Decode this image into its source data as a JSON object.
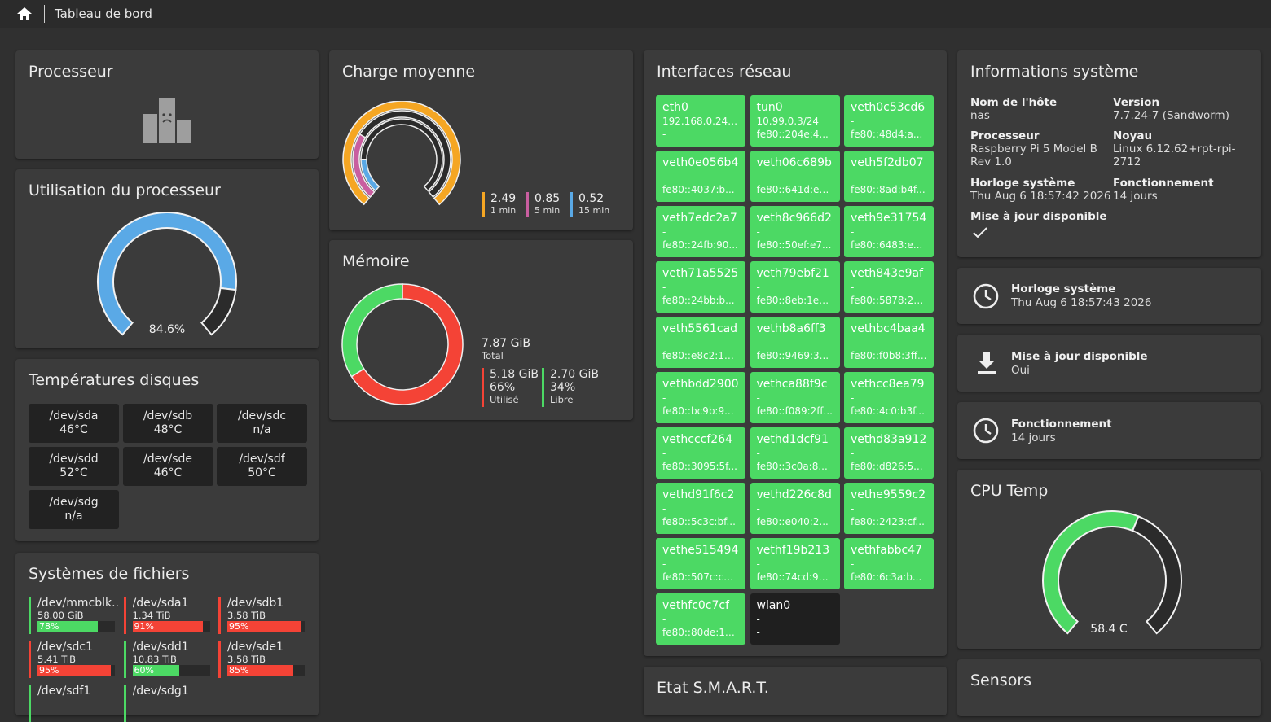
{
  "breadcrumb": {
    "title": "Tableau de bord"
  },
  "colors": {
    "green": "#4cd964",
    "red": "#f44336",
    "blue": "#5aa9e6",
    "orange": "#f5a623",
    "pink": "#c95ea0",
    "lightblue": "#5aa9e6"
  },
  "processor": {
    "title": "Processeur",
    "icon": "sad-building-icon"
  },
  "cpu_usage": {
    "title": "Utilisation du processeur",
    "value_label": "84.6%",
    "value": 84.6
  },
  "load": {
    "title": "Charge moyenne",
    "items": [
      {
        "value": "2.49",
        "label": "1 min"
      },
      {
        "value": "0.85",
        "label": "5 min"
      },
      {
        "value": "0.52",
        "label": "15 min"
      }
    ]
  },
  "memory": {
    "title": "Mémoire",
    "total_value": "7.87 GiB",
    "total_label": "Total",
    "used_value": "5.18 GiB",
    "used_pct": "66%",
    "used_label": "Utilisé",
    "free_value": "2.70 GiB",
    "free_pct": "34%",
    "free_label": "Libre",
    "used_fraction": 0.66
  },
  "disk_temps": {
    "title": "Températures disques",
    "items": [
      {
        "dev": "/dev/sda",
        "temp": "46°C"
      },
      {
        "dev": "/dev/sdb",
        "temp": "48°C"
      },
      {
        "dev": "/dev/sdc",
        "temp": "n/a"
      },
      {
        "dev": "/dev/sdd",
        "temp": "52°C"
      },
      {
        "dev": "/dev/sde",
        "temp": "46°C"
      },
      {
        "dev": "/dev/sdf",
        "temp": "50°C"
      },
      {
        "dev": "/dev/sdg",
        "temp": "n/a"
      }
    ]
  },
  "filesystems": {
    "title": "Systèmes de fichiers",
    "items": [
      {
        "name": "/dev/mmcblk...",
        "size": "58.00 GiB",
        "pct": "78%",
        "value": 78,
        "color": "#4cd964"
      },
      {
        "name": "/dev/sda1",
        "size": "1.34 TiB",
        "pct": "91%",
        "value": 91,
        "color": "#f44336"
      },
      {
        "name": "/dev/sdb1",
        "size": "3.58 TiB",
        "pct": "95%",
        "value": 95,
        "color": "#f44336"
      },
      {
        "name": "/dev/sdc1",
        "size": "5.41 TiB",
        "pct": "95%",
        "value": 95,
        "color": "#f44336"
      },
      {
        "name": "/dev/sdd1",
        "size": "10.83 TiB",
        "pct": "60%",
        "value": 60,
        "color": "#4cd964"
      },
      {
        "name": "/dev/sde1",
        "size": "3.58 TiB",
        "pct": "85%",
        "value": 85,
        "color": "#f44336"
      },
      {
        "name": "/dev/sdf1",
        "size": "",
        "pct": "",
        "value": 0,
        "color": "#4cd964"
      },
      {
        "name": "/dev/sdg1",
        "size": "",
        "pct": "",
        "value": 0,
        "color": "#4cd964"
      }
    ]
  },
  "network": {
    "title": "Interfaces réseau",
    "items": [
      {
        "name": "eth0",
        "ipv4": "192.168.0.241/...",
        "ipv6": "-",
        "active": true
      },
      {
        "name": "tun0",
        "ipv4": "10.99.0.3/24",
        "ipv6": "fe80::204e:4...",
        "active": true
      },
      {
        "name": "veth0c53cd6",
        "ipv4": "-",
        "ipv6": "fe80::48d4:a...",
        "active": true
      },
      {
        "name": "veth0e056b4",
        "ipv4": "-",
        "ipv6": "fe80::4037:b...",
        "active": true
      },
      {
        "name": "veth06c689b",
        "ipv4": "-",
        "ipv6": "fe80::641d:e7...",
        "active": true
      },
      {
        "name": "veth5f2db07",
        "ipv4": "-",
        "ipv6": "fe80::8ad:b4f...",
        "active": true
      },
      {
        "name": "veth7edc2a7",
        "ipv4": "-",
        "ipv6": "fe80::24fb:90...",
        "active": true
      },
      {
        "name": "veth8c966d2",
        "ipv4": "-",
        "ipv6": "fe80::50ef:e7...",
        "active": true
      },
      {
        "name": "veth9e31754",
        "ipv4": "-",
        "ipv6": "fe80::6483:e...",
        "active": true
      },
      {
        "name": "veth71a5525",
        "ipv4": "-",
        "ipv6": "fe80::24bb:b...",
        "active": true
      },
      {
        "name": "veth79ebf21",
        "ipv4": "-",
        "ipv6": "fe80::8eb:1eff...",
        "active": true
      },
      {
        "name": "veth843e9af",
        "ipv4": "-",
        "ipv6": "fe80::5878:2e...",
        "active": true
      },
      {
        "name": "veth5561cad",
        "ipv4": "-",
        "ipv6": "fe80::e8c2:11f...",
        "active": true
      },
      {
        "name": "vethb8a6ff3",
        "ipv4": "-",
        "ipv6": "fe80::9469:3...",
        "active": true
      },
      {
        "name": "vethbc4baa4",
        "ipv4": "-",
        "ipv6": "fe80::f0b8:3ff...",
        "active": true
      },
      {
        "name": "vethbdd2900",
        "ipv4": "-",
        "ipv6": "fe80::bc9b:9...",
        "active": true
      },
      {
        "name": "vethca88f9c",
        "ipv4": "-",
        "ipv6": "fe80::f089:2ff...",
        "active": true
      },
      {
        "name": "vethcc8ea79",
        "ipv4": "-",
        "ipv6": "fe80::4c0:b3f...",
        "active": true
      },
      {
        "name": "vethcccf264",
        "ipv4": "-",
        "ipv6": "fe80::3095:5f...",
        "active": true
      },
      {
        "name": "vethd1dcf91",
        "ipv4": "-",
        "ipv6": "fe80::3c0a:8...",
        "active": true
      },
      {
        "name": "vethd83a912",
        "ipv4": "-",
        "ipv6": "fe80::d826:5...",
        "active": true
      },
      {
        "name": "vethd91f6c2",
        "ipv4": "-",
        "ipv6": "fe80::5c3c:bf...",
        "active": true
      },
      {
        "name": "vethd226c8d",
        "ipv4": "-",
        "ipv6": "fe80::e040:2...",
        "active": true
      },
      {
        "name": "vethe9559c2",
        "ipv4": "-",
        "ipv6": "fe80::2423:cf...",
        "active": true
      },
      {
        "name": "vethe515494",
        "ipv4": "-",
        "ipv6": "fe80::507c:c1f...",
        "active": true
      },
      {
        "name": "vethf19b213",
        "ipv4": "-",
        "ipv6": "fe80::74cd:9e...",
        "active": true
      },
      {
        "name": "vethfabbc47",
        "ipv4": "-",
        "ipv6": "fe80::6c3a:b...",
        "active": true
      },
      {
        "name": "vethfc0c7cf",
        "ipv4": "-",
        "ipv6": "fe80::80de:10...",
        "active": true
      },
      {
        "name": "wlan0",
        "ipv4": "-",
        "ipv6": "-",
        "active": false
      }
    ]
  },
  "smart": {
    "title": "Etat S.M.A.R.T."
  },
  "sysinfo": {
    "title": "Informations système",
    "hostname_label": "Nom de l'hôte",
    "hostname": "nas",
    "version_label": "Version",
    "version": "7.7.24-7 (Sandworm)",
    "cpu_label": "Processeur",
    "cpu": "Raspberry Pi 5 Model B Rev 1.0",
    "kernel_label": "Noyau",
    "kernel": "Linux 6.12.62+rpt-rpi-2712",
    "clock_label": "Horloge système",
    "clock": "Thu Aug 6 18:57:42 2026",
    "uptime_label": "Fonctionnement",
    "uptime": "14 jours",
    "update_label": "Mise à jour disponible",
    "update_icon": "check-icon"
  },
  "clock_card": {
    "title": "Horloge système",
    "value": "Thu Aug 6 18:57:43 2026",
    "icon": "clock-icon"
  },
  "update_card": {
    "title": "Mise à jour disponible",
    "value": "Oui",
    "icon": "download-icon"
  },
  "uptime_card": {
    "title": "Fonctionnement",
    "value": "14 jours",
    "icon": "clock-icon"
  },
  "cpu_temp": {
    "title": "CPU Temp",
    "value_label": "58.4 C",
    "fraction": 0.58
  },
  "sensors": {
    "title": "Sensors"
  }
}
